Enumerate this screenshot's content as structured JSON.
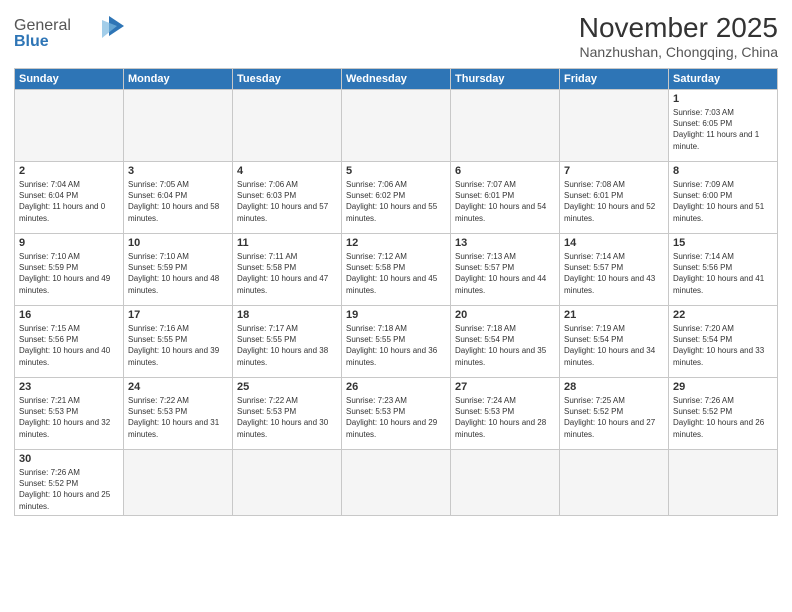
{
  "logo": {
    "text_general": "General",
    "text_blue": "Blue"
  },
  "header": {
    "month_title": "November 2025",
    "subtitle": "Nanzhushan, Chongqing, China"
  },
  "weekdays": [
    "Sunday",
    "Monday",
    "Tuesday",
    "Wednesday",
    "Thursday",
    "Friday",
    "Saturday"
  ],
  "days": {
    "d1": {
      "num": "1",
      "sunrise": "7:03 AM",
      "sunset": "6:05 PM",
      "daylight": "11 hours and 1 minute."
    },
    "d2": {
      "num": "2",
      "sunrise": "7:04 AM",
      "sunset": "6:04 PM",
      "daylight": "11 hours and 0 minutes."
    },
    "d3": {
      "num": "3",
      "sunrise": "7:05 AM",
      "sunset": "6:04 PM",
      "daylight": "10 hours and 58 minutes."
    },
    "d4": {
      "num": "4",
      "sunrise": "7:06 AM",
      "sunset": "6:03 PM",
      "daylight": "10 hours and 57 minutes."
    },
    "d5": {
      "num": "5",
      "sunrise": "7:06 AM",
      "sunset": "6:02 PM",
      "daylight": "10 hours and 55 minutes."
    },
    "d6": {
      "num": "6",
      "sunrise": "7:07 AM",
      "sunset": "6:01 PM",
      "daylight": "10 hours and 54 minutes."
    },
    "d7": {
      "num": "7",
      "sunrise": "7:08 AM",
      "sunset": "6:01 PM",
      "daylight": "10 hours and 52 minutes."
    },
    "d8": {
      "num": "8",
      "sunrise": "7:09 AM",
      "sunset": "6:00 PM",
      "daylight": "10 hours and 51 minutes."
    },
    "d9": {
      "num": "9",
      "sunrise": "7:10 AM",
      "sunset": "5:59 PM",
      "daylight": "10 hours and 49 minutes."
    },
    "d10": {
      "num": "10",
      "sunrise": "7:10 AM",
      "sunset": "5:59 PM",
      "daylight": "10 hours and 48 minutes."
    },
    "d11": {
      "num": "11",
      "sunrise": "7:11 AM",
      "sunset": "5:58 PM",
      "daylight": "10 hours and 47 minutes."
    },
    "d12": {
      "num": "12",
      "sunrise": "7:12 AM",
      "sunset": "5:58 PM",
      "daylight": "10 hours and 45 minutes."
    },
    "d13": {
      "num": "13",
      "sunrise": "7:13 AM",
      "sunset": "5:57 PM",
      "daylight": "10 hours and 44 minutes."
    },
    "d14": {
      "num": "14",
      "sunrise": "7:14 AM",
      "sunset": "5:57 PM",
      "daylight": "10 hours and 43 minutes."
    },
    "d15": {
      "num": "15",
      "sunrise": "7:14 AM",
      "sunset": "5:56 PM",
      "daylight": "10 hours and 41 minutes."
    },
    "d16": {
      "num": "16",
      "sunrise": "7:15 AM",
      "sunset": "5:56 PM",
      "daylight": "10 hours and 40 minutes."
    },
    "d17": {
      "num": "17",
      "sunrise": "7:16 AM",
      "sunset": "5:55 PM",
      "daylight": "10 hours and 39 minutes."
    },
    "d18": {
      "num": "18",
      "sunrise": "7:17 AM",
      "sunset": "5:55 PM",
      "daylight": "10 hours and 38 minutes."
    },
    "d19": {
      "num": "19",
      "sunrise": "7:18 AM",
      "sunset": "5:55 PM",
      "daylight": "10 hours and 36 minutes."
    },
    "d20": {
      "num": "20",
      "sunrise": "7:18 AM",
      "sunset": "5:54 PM",
      "daylight": "10 hours and 35 minutes."
    },
    "d21": {
      "num": "21",
      "sunrise": "7:19 AM",
      "sunset": "5:54 PM",
      "daylight": "10 hours and 34 minutes."
    },
    "d22": {
      "num": "22",
      "sunrise": "7:20 AM",
      "sunset": "5:54 PM",
      "daylight": "10 hours and 33 minutes."
    },
    "d23": {
      "num": "23",
      "sunrise": "7:21 AM",
      "sunset": "5:53 PM",
      "daylight": "10 hours and 32 minutes."
    },
    "d24": {
      "num": "24",
      "sunrise": "7:22 AM",
      "sunset": "5:53 PM",
      "daylight": "10 hours and 31 minutes."
    },
    "d25": {
      "num": "25",
      "sunrise": "7:22 AM",
      "sunset": "5:53 PM",
      "daylight": "10 hours and 30 minutes."
    },
    "d26": {
      "num": "26",
      "sunrise": "7:23 AM",
      "sunset": "5:53 PM",
      "daylight": "10 hours and 29 minutes."
    },
    "d27": {
      "num": "27",
      "sunrise": "7:24 AM",
      "sunset": "5:53 PM",
      "daylight": "10 hours and 28 minutes."
    },
    "d28": {
      "num": "28",
      "sunrise": "7:25 AM",
      "sunset": "5:52 PM",
      "daylight": "10 hours and 27 minutes."
    },
    "d29": {
      "num": "29",
      "sunrise": "7:26 AM",
      "sunset": "5:52 PM",
      "daylight": "10 hours and 26 minutes."
    },
    "d30": {
      "num": "30",
      "sunrise": "7:26 AM",
      "sunset": "5:52 PM",
      "daylight": "10 hours and 25 minutes."
    }
  }
}
